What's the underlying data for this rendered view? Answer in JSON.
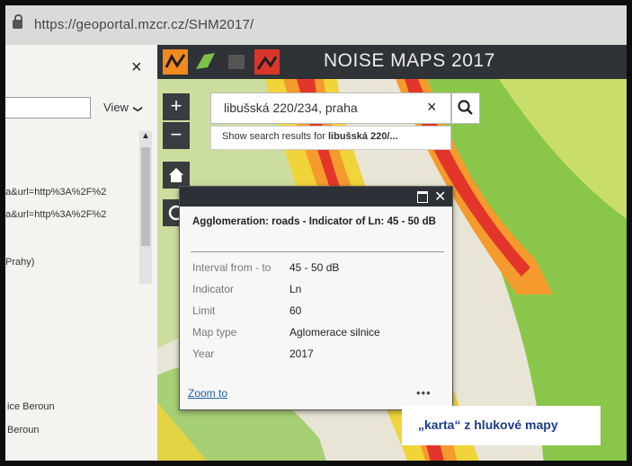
{
  "browser": {
    "url": "https://geoportal.mzcr.cz/SHM2017/"
  },
  "left_panel": {
    "close": "×",
    "view_label": "View",
    "chevron": "❯",
    "lines": [
      "pa&url=http%3A%2F%2",
      "pa&url=http%3A%2F%2",
      "Prahy)",
      "ice Beroun",
      "Beroun"
    ]
  },
  "map": {
    "title": "NOISE MAPS 2017",
    "zoom_in": "+",
    "zoom_out": "−",
    "search": {
      "value": "libušská 220/234, praha",
      "clear": "×",
      "suggestion_prefix": "Show search results for ",
      "suggestion_bold": "libušská 220/..."
    }
  },
  "popup": {
    "title": "Agglomeration: roads - Indicator of Ln: 45 - 50 dB",
    "rows": [
      {
        "label": "Interval from - to",
        "value": "45 - 50 dB"
      },
      {
        "label": "Indicator",
        "value": "Ln"
      },
      {
        "label": "Limit",
        "value": "60"
      },
      {
        "label": "Map type",
        "value": "Aglomerace silnice"
      },
      {
        "label": "Year",
        "value": "2017"
      }
    ],
    "zoom_to": "Zoom to",
    "more": "•••"
  },
  "caption": {
    "text": "„karta“ z hlukové mapy"
  },
  "colors": {
    "accent": "#e2362a",
    "band_orange": "#f59a2c",
    "band_yellow": "#f1d33a",
    "band_green": "#8ac64a",
    "topbar": "#2f3237",
    "caption_text": "#1d3b86"
  }
}
